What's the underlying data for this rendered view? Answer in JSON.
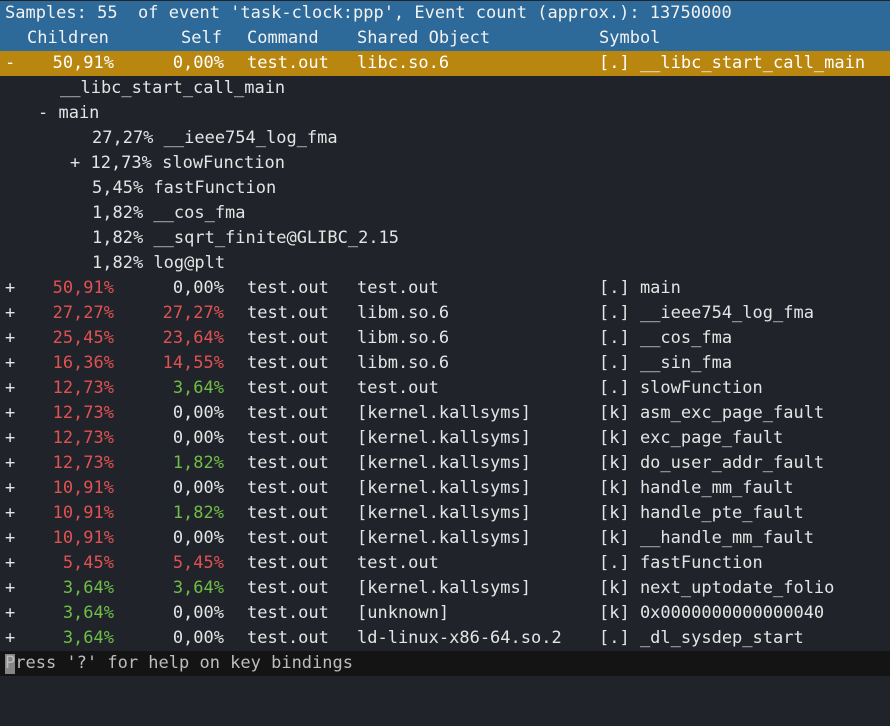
{
  "title_bar": "Samples: 55  of event 'task-clock:ppp', Event count (approx.): 13750000",
  "headers": {
    "children": "Children",
    "self": "Self",
    "command": "Command",
    "shared_object": "Shared Object",
    "symbol": "Symbol"
  },
  "selected_row": {
    "marker": "-",
    "children": "50,91%",
    "self": "0,00%",
    "command": "test.out",
    "shared_object": "libc.so.6",
    "symbol": "[.] __libc_start_call_main"
  },
  "callchain": [
    {
      "text": "__libc_start_call_main"
    },
    {
      "text": "- main"
    },
    {
      "text": "27,27% __ieee754_log_fma"
    },
    {
      "text": "+ 12,73% slowFunction"
    },
    {
      "text": "5,45% fastFunction"
    },
    {
      "text": "1,82% __cos_fma"
    },
    {
      "text": "1,82% __sqrt_finite@GLIBC_2.15"
    },
    {
      "text": "1,82% log@plt"
    }
  ],
  "rows": [
    {
      "marker": "+",
      "children": "50,91%",
      "self": "0,00%",
      "command": "test.out",
      "shared_object": "test.out",
      "symbol": "[.] main",
      "children_color": "#e05252",
      "self_color": "#e4e4e4"
    },
    {
      "marker": "+",
      "children": "27,27%",
      "self": "27,27%",
      "command": "test.out",
      "shared_object": "libm.so.6",
      "symbol": "[.] __ieee754_log_fma",
      "children_color": "#e05252",
      "self_color": "#e05252"
    },
    {
      "marker": "+",
      "children": "25,45%",
      "self": "23,64%",
      "command": "test.out",
      "shared_object": "libm.so.6",
      "symbol": "[.] __cos_fma",
      "children_color": "#e05252",
      "self_color": "#e05252"
    },
    {
      "marker": "+",
      "children": "16,36%",
      "self": "14,55%",
      "command": "test.out",
      "shared_object": "libm.so.6",
      "symbol": "[.] __sin_fma",
      "children_color": "#e05252",
      "self_color": "#e05252"
    },
    {
      "marker": "+",
      "children": "12,73%",
      "self": "3,64%",
      "command": "test.out",
      "shared_object": "test.out",
      "symbol": "[.] slowFunction",
      "children_color": "#e05252",
      "self_color": "#6fbf47"
    },
    {
      "marker": "+",
      "children": "12,73%",
      "self": "0,00%",
      "command": "test.out",
      "shared_object": "[kernel.kallsyms]",
      "symbol": "[k] asm_exc_page_fault",
      "children_color": "#e05252",
      "self_color": "#e4e4e4"
    },
    {
      "marker": "+",
      "children": "12,73%",
      "self": "0,00%",
      "command": "test.out",
      "shared_object": "[kernel.kallsyms]",
      "symbol": "[k] exc_page_fault",
      "children_color": "#e05252",
      "self_color": "#e4e4e4"
    },
    {
      "marker": "+",
      "children": "12,73%",
      "self": "1,82%",
      "command": "test.out",
      "shared_object": "[kernel.kallsyms]",
      "symbol": "[k] do_user_addr_fault",
      "children_color": "#e05252",
      "self_color": "#6fbf47"
    },
    {
      "marker": "+",
      "children": "10,91%",
      "self": "0,00%",
      "command": "test.out",
      "shared_object": "[kernel.kallsyms]",
      "symbol": "[k] handle_mm_fault",
      "children_color": "#e05252",
      "self_color": "#e4e4e4"
    },
    {
      "marker": "+",
      "children": "10,91%",
      "self": "1,82%",
      "command": "test.out",
      "shared_object": "[kernel.kallsyms]",
      "symbol": "[k] handle_pte_fault",
      "children_color": "#e05252",
      "self_color": "#6fbf47"
    },
    {
      "marker": "+",
      "children": "10,91%",
      "self": "0,00%",
      "command": "test.out",
      "shared_object": "[kernel.kallsyms]",
      "symbol": "[k] __handle_mm_fault",
      "children_color": "#e05252",
      "self_color": "#e4e4e4"
    },
    {
      "marker": "+",
      "children": "5,45%",
      "self": "5,45%",
      "command": "test.out",
      "shared_object": "test.out",
      "symbol": "[.] fastFunction",
      "children_color": "#e05252",
      "self_color": "#e05252"
    },
    {
      "marker": "+",
      "children": "3,64%",
      "self": "3,64%",
      "command": "test.out",
      "shared_object": "[kernel.kallsyms]",
      "symbol": "[k] next_uptodate_folio",
      "children_color": "#6fbf47",
      "self_color": "#6fbf47"
    },
    {
      "marker": "+",
      "children": "3,64%",
      "self": "0,00%",
      "command": "test.out",
      "shared_object": "[unknown]",
      "symbol": "[k] 0x0000000000000040",
      "children_color": "#6fbf47",
      "self_color": "#e4e4e4"
    },
    {
      "marker": "+",
      "children": "3,64%",
      "self": "0,00%",
      "command": "test.out",
      "shared_object": "ld-linux-x86-64.so.2",
      "symbol": "[.] _dl_sysdep_start",
      "children_color": "#6fbf47",
      "self_color": "#e4e4e4"
    }
  ],
  "status_bar": "Press '?' for help on key bindings",
  "colors": {
    "header_bg": "#2d6a99",
    "selected_bg": "#b9870f",
    "high_percent": "#e05252",
    "low_percent": "#6fbf47",
    "background": "#20232a"
  }
}
